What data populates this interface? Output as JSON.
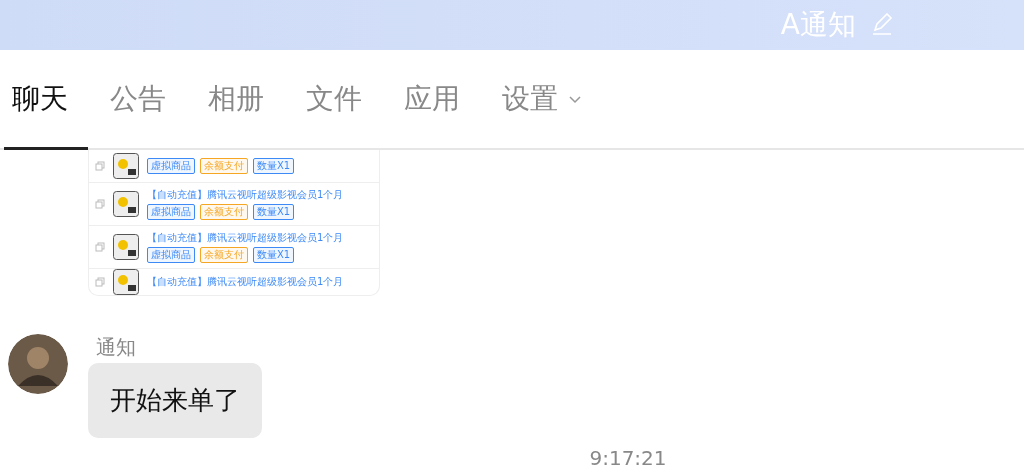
{
  "header": {
    "title": "A通知"
  },
  "tabs": [
    {
      "label": "聊天",
      "selected": true,
      "dropdown": false
    },
    {
      "label": "公告",
      "selected": false,
      "dropdown": false
    },
    {
      "label": "相册",
      "selected": false,
      "dropdown": false
    },
    {
      "label": "文件",
      "selected": false,
      "dropdown": false
    },
    {
      "label": "应用",
      "selected": false,
      "dropdown": false
    },
    {
      "label": "设置",
      "selected": false,
      "dropdown": true
    }
  ],
  "messages": [
    {
      "kind": "screenshot",
      "rows": [
        {
          "tags": [
            {
              "text": "虚拟商品",
              "color": "#3d8af7"
            },
            {
              "text": "余额支付",
              "color": "#f5a623"
            },
            {
              "text": "数量X1",
              "color": "#3d8af7"
            }
          ]
        },
        {
          "title": "【自动充值】腾讯云视听超级影视会员1个月",
          "tags": [
            {
              "text": "虚拟商品",
              "color": "#3d8af7"
            },
            {
              "text": "余额支付",
              "color": "#f5a623"
            },
            {
              "text": "数量X1",
              "color": "#3d8af7"
            }
          ]
        },
        {
          "title": "【自动充值】腾讯云视听超级影视会员1个月",
          "tags": [
            {
              "text": "虚拟商品",
              "color": "#3d8af7"
            },
            {
              "text": "余额支付",
              "color": "#f5a623"
            },
            {
              "text": "数量X1",
              "color": "#3d8af7"
            }
          ]
        },
        {
          "title": "【自动充值】腾讯云视听超级影视会员1个月"
        }
      ]
    },
    {
      "kind": "text",
      "sender": "通知",
      "text": "开始来单了"
    }
  ],
  "timestamp": "9:17:21"
}
